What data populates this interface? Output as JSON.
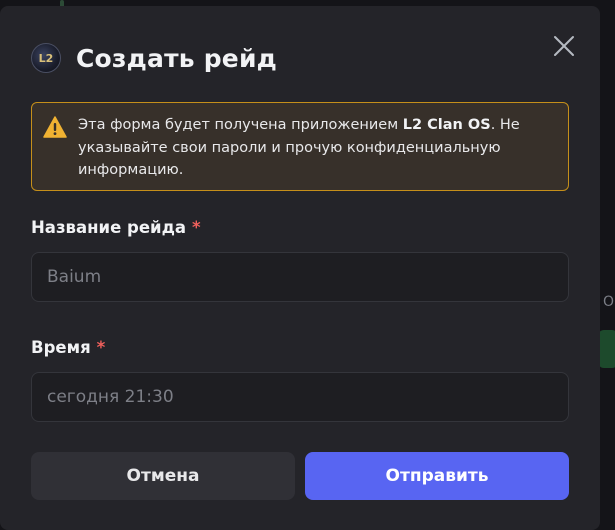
{
  "modal": {
    "title": "Создать рейд",
    "app_icon_text": "L2"
  },
  "warning": {
    "text_before": "Эта форма будет получена приложением ",
    "app_name": "L2 Clan OS",
    "text_after": ". Не указывайте свои пароли и прочую конфиденциальную информацию.",
    "border_color": "#c58f1a",
    "icon": "warning-triangle-icon"
  },
  "fields": {
    "raid_name": {
      "label": "Название рейда",
      "required_mark": "*",
      "placeholder": "Baium",
      "value": ""
    },
    "time": {
      "label": "Время",
      "required_mark": "*",
      "placeholder": "сегодня 21:30",
      "value": ""
    }
  },
  "buttons": {
    "cancel": "Отмена",
    "submit": "Отправить"
  },
  "background": {
    "partial_letter": "О"
  },
  "colors": {
    "accent": "#5865f2",
    "required": "#f0605c",
    "modal_bg": "#242429"
  }
}
